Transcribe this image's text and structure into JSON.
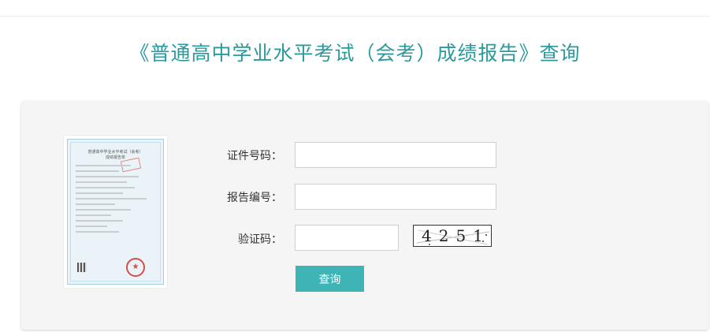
{
  "page": {
    "title": "《普通高中学业水平考试（会考）成绩报告》查询"
  },
  "sample_report": {
    "heading": "普通高中学业水平考试（会考）\n成绩报告单"
  },
  "form": {
    "id_number_label": "证件号码：",
    "id_number_value": "",
    "report_number_label": "报告编号：",
    "report_number_value": "",
    "captcha_label": "验证码：",
    "captcha_value": "",
    "captcha_image_text": "4251",
    "submit_label": "查询"
  },
  "colors": {
    "title": "#2a9a9e",
    "button": "#3eb4b7",
    "panel": "#f5f5f5"
  }
}
